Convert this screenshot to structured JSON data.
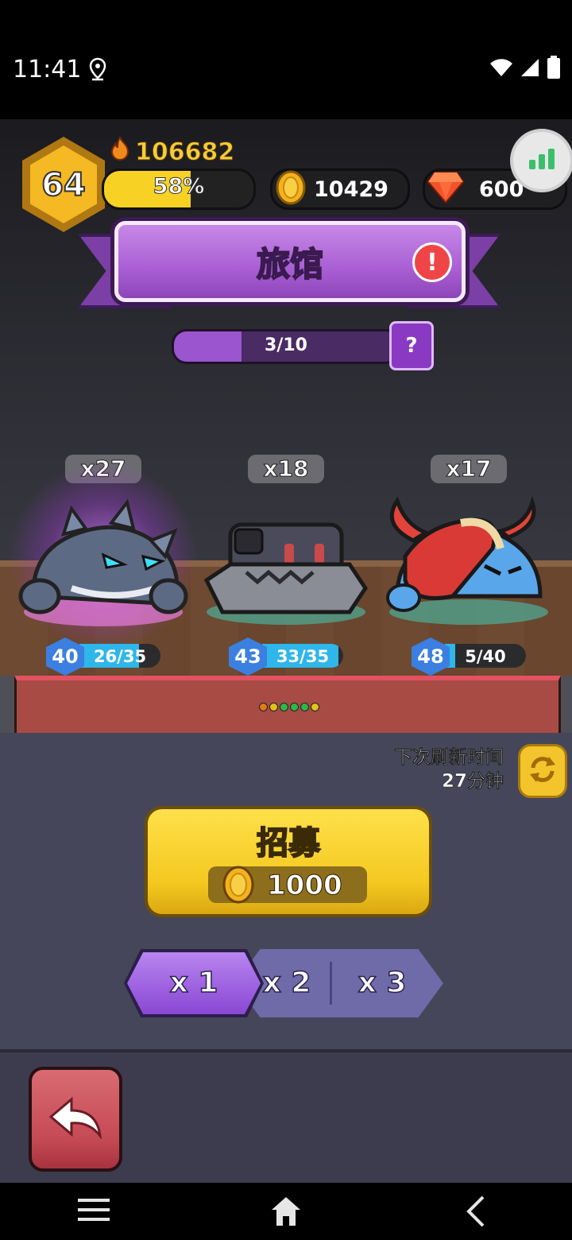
{
  "status_bar": {
    "time": "11:41"
  },
  "player": {
    "level": "64",
    "power": "106682",
    "xp_percent": "58%",
    "xp_fraction": 0.58
  },
  "resources": {
    "coins": "10429",
    "gems": "600"
  },
  "banner": {
    "title": "旅馆"
  },
  "progress": {
    "text": "3/10",
    "fraction": 0.3,
    "help": "?"
  },
  "heroes": [
    {
      "count": "x27",
      "level": "40",
      "shards": "26/35",
      "fill": 0.74
    },
    {
      "count": "x18",
      "level": "43",
      "shards": "33/35",
      "fill": 0.94
    },
    {
      "count": "x17",
      "level": "48",
      "shards": "5/40",
      "fill": 0.125
    }
  ],
  "refresh": {
    "line1": "下次刷新时间",
    "line2": "27分钟"
  },
  "recruit": {
    "label": "招募",
    "cost": "1000"
  },
  "multipliers": [
    "x 1",
    "x 2",
    "x 3"
  ],
  "colors": {
    "accent_purple": "#9b55cf",
    "gold": "#f5c820",
    "back_red": "#c54a55"
  },
  "icons": [
    "location-icon",
    "wifi-icon",
    "cell-signal-icon",
    "battery-icon",
    "flame-icon",
    "coin-icon",
    "gem-icon",
    "stats-icon",
    "alert-icon",
    "refresh-icon",
    "back-arrow-icon",
    "menu-icon",
    "home-icon",
    "back-nav-icon"
  ]
}
